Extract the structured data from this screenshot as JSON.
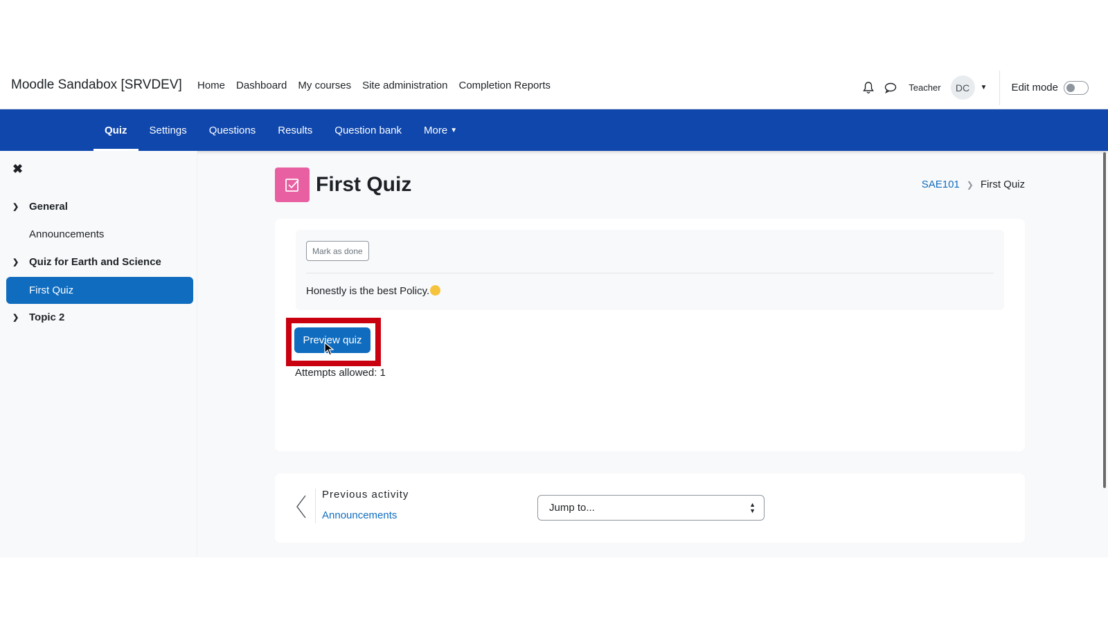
{
  "site": {
    "brand": "Moodle Sandabox [SRVDEV]"
  },
  "primary_nav": [
    "Home",
    "Dashboard",
    "My courses",
    "Site administration",
    "Completion Reports"
  ],
  "user": {
    "role": "Teacher",
    "initials": "DC",
    "edit_mode_label": "Edit mode"
  },
  "secondary_nav": {
    "items": [
      "Quiz",
      "Settings",
      "Questions",
      "Results",
      "Question bank"
    ],
    "more_label": "More",
    "active": "Quiz"
  },
  "drawer": {
    "sections": [
      {
        "label": "General",
        "items": [
          "Announcements"
        ]
      },
      {
        "label": "Quiz for Earth and Science",
        "items": [
          "First Quiz"
        ]
      },
      {
        "label": "Topic 2",
        "items": []
      }
    ],
    "active_item": "First Quiz"
  },
  "page": {
    "title": "First Quiz",
    "breadcrumb": [
      "SAE101",
      "First Quiz"
    ],
    "mark_done_label": "Mark as done",
    "description": "Honestly is the best Policy.",
    "preview_button": "Preview quiz",
    "attempts": "Attempts allowed: 1"
  },
  "activity_nav": {
    "previous_label": "Previous activity",
    "previous_link": "Announcements",
    "jump_placeholder": "Jump to..."
  },
  "colors": {
    "primary": "#0f6cbf",
    "secnav": "#0f47ad",
    "quiz_icon": "#e85fa2",
    "highlight": "#c8000f"
  }
}
